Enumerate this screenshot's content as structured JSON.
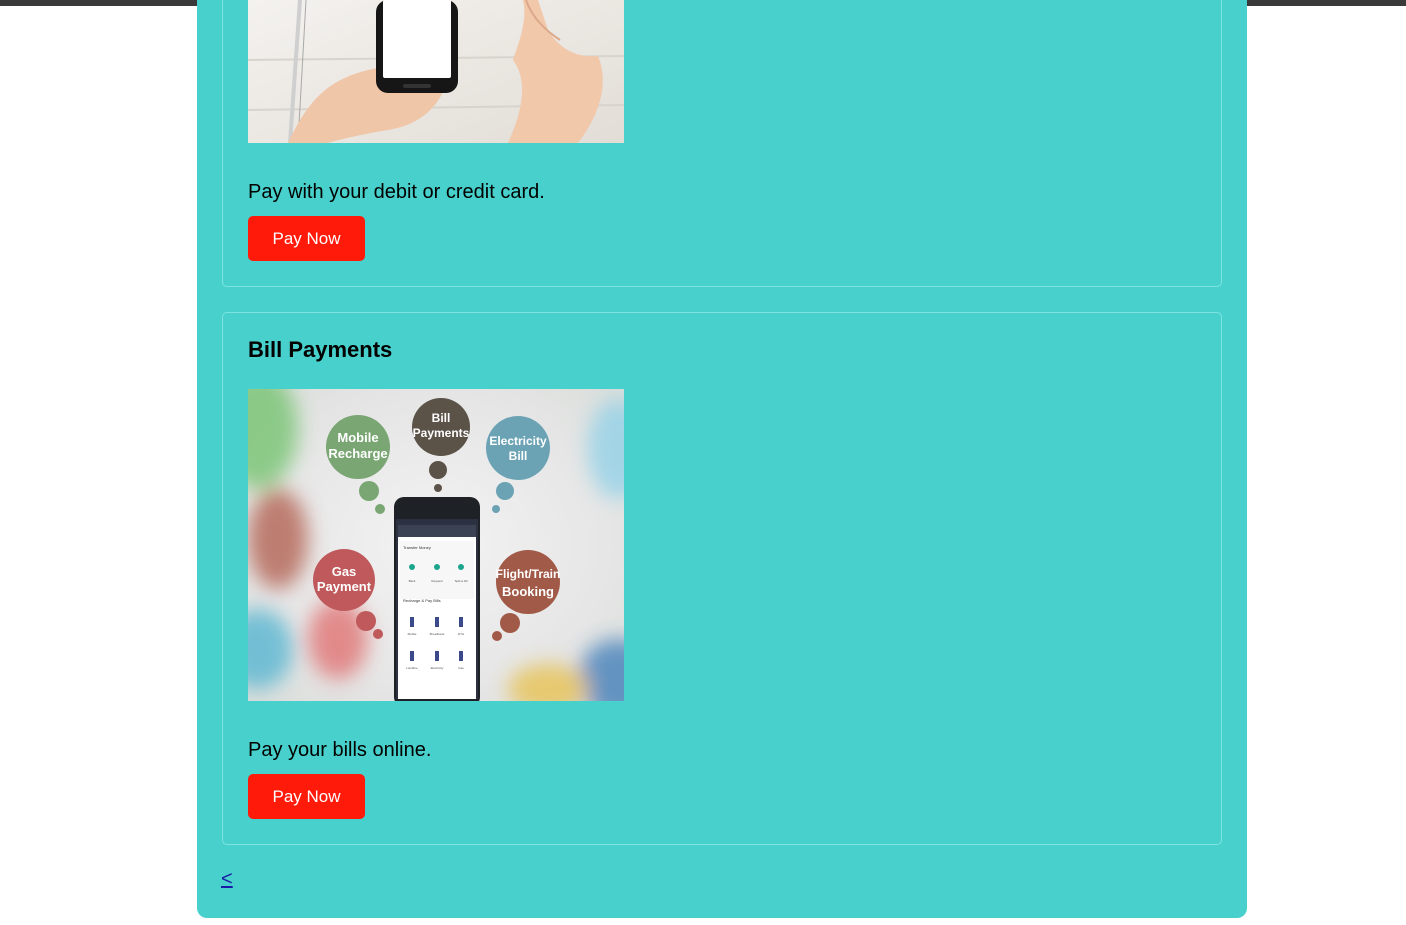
{
  "cards": [
    {
      "description": "Pay with your debit or credit card.",
      "button_label": "Pay Now",
      "image_subject": "hands-holding-phone"
    },
    {
      "title": "Bill Payments",
      "description": "Pay your bills online.",
      "button_label": "Pay Now",
      "image_bubbles": {
        "mobile": [
          "Mobile",
          "Recharge"
        ],
        "bill": [
          "Bill",
          "Payments"
        ],
        "electricity": [
          "Electricity",
          "Bill"
        ],
        "gas": [
          "Gas",
          "Payment"
        ],
        "flight": [
          "Flight/Train",
          "Booking"
        ]
      },
      "phone_screen": {
        "section1": "Transfer Money",
        "section2": "Recharge & Pay Bills",
        "row1": [
          "Bank",
          "Request",
          "Split a bill"
        ],
        "row2": [
          "Mobile",
          "Broadband",
          "DTH"
        ],
        "row3": [
          "Landline",
          "Electricity",
          "Gas"
        ]
      }
    }
  ],
  "back_link": "<",
  "colors": {
    "page_bg": "#48d1cc",
    "button": "#ff1a0a",
    "link": "#1a1aa6",
    "bubble_mobile": "#7aa673",
    "bubble_bill": "#5b5248",
    "bubble_electricity": "#6ba3b4",
    "bubble_gas": "#c0595b",
    "bubble_flight": "#a25a48"
  }
}
